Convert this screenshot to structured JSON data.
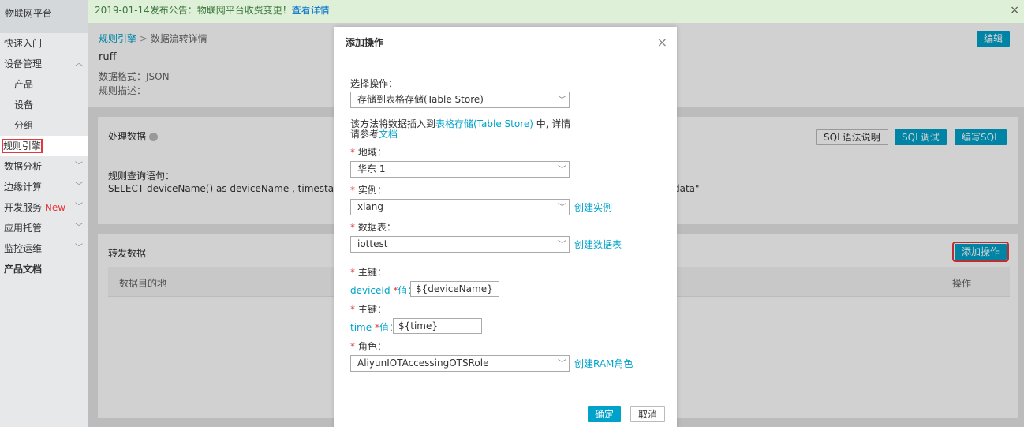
{
  "sidebar": {
    "logo": "物联网平台",
    "items": [
      {
        "label": "快速入门"
      },
      {
        "label": "设备管理"
      },
      {
        "label": "产品"
      },
      {
        "label": "设备"
      },
      {
        "label": "分组"
      },
      {
        "label": "规则引擎"
      },
      {
        "label": "数据分析"
      },
      {
        "label": "边缘计算"
      },
      {
        "label": "开发服务",
        "badge": "New"
      },
      {
        "label": "应用托管"
      },
      {
        "label": "监控运维"
      },
      {
        "label": "产品文档"
      }
    ]
  },
  "notice": {
    "text": "2019-01-14发布公告：物联网平台收费变更！",
    "link": "查看详情",
    "close": "×"
  },
  "breadcrumb": {
    "root": "规则引擎",
    "sep": ">",
    "current": "数据流转详情"
  },
  "rule": {
    "name": "ruff",
    "format": "数据格式：JSON",
    "desc": "规则描述：",
    "edit": "编辑"
  },
  "process": {
    "title": "处理数据",
    "sql_help": "SQL语法说明",
    "sql_debug": "SQL调试",
    "sql_write": "编写SQL",
    "query_label": "规则查询语句：",
    "query_start": "SELECT deviceName() as deviceName , timestamp('y",
    "query_end": "data\""
  },
  "forward": {
    "title": "转发数据",
    "add": "添加操作",
    "col_dest": "数据目的地",
    "col_op": "操作"
  },
  "modal": {
    "title": "添加操作",
    "close": "×",
    "choose_label": "选择操作：",
    "choose_value": "存储到表格存储(Table Store)",
    "desc_pre": "该方法将数据插入到",
    "desc_link": "表格存储(Table Store)",
    "desc_mid": " 中, 详情",
    "desc_line2": "请参考",
    "desc_doc": "文档",
    "region_label": "地域：",
    "region_value": "华东 1",
    "instance_label": "实例：",
    "instance_value": "xiang",
    "instance_link": "创建实例",
    "table_label": "数据表：",
    "table_value": "iottest",
    "table_link": "创建数据表",
    "pk1_label": "主键：",
    "pk1_name": "deviceId",
    "pk1_val_label": "值：",
    "pk1_value": "${deviceName}",
    "pk2_label": "主键：",
    "pk2_name": "time",
    "pk2_val_label": "值：",
    "pk2_value": "${time}",
    "role_label": "角色：",
    "role_value": "AliyunIOTAccessingOTSRole",
    "role_link": "创建RAM角色",
    "ok": "确定",
    "cancel": "取消"
  }
}
